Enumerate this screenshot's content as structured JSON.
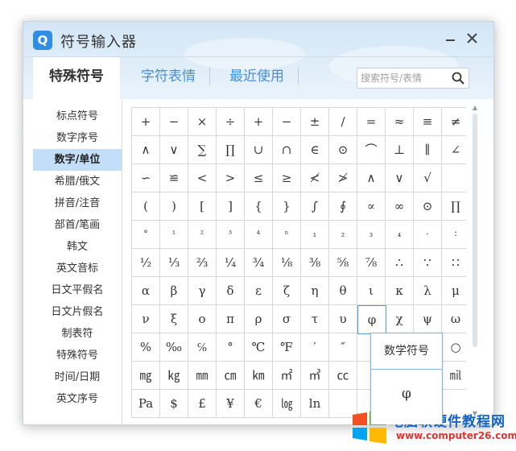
{
  "window": {
    "title": "符号输入器",
    "logo": "Q"
  },
  "tabs": [
    "特殊符号",
    "字符表情",
    "最近使用"
  ],
  "search": {
    "placeholder": "搜索符号/表情"
  },
  "sidebar": [
    "标点符号",
    "数字序号",
    "数字/单位",
    "希腊/俄文",
    "拼音/注音",
    "部首/笔画",
    "韩文",
    "英文音标",
    "日文平假名",
    "日文片假名",
    "制表符",
    "特殊符号",
    "时间/日期",
    "英文序号"
  ],
  "sidebar_active": 2,
  "grid": [
    [
      "+",
      "−",
      "×",
      "÷",
      "+",
      "−",
      "±",
      "∕",
      "=",
      "≈",
      "≡",
      "≠"
    ],
    [
      "∧",
      "∨",
      "∑",
      "∏",
      "∪",
      "∩",
      "∈",
      "⊙",
      "⌒",
      "⊥",
      "∥",
      "∠"
    ],
    [
      "∽",
      "≌",
      "<",
      ">",
      "≤",
      "≥",
      "≮",
      "≯",
      "∧",
      "∨",
      "√",
      ""
    ],
    [
      "(",
      ")",
      "[",
      "]",
      "{",
      "}",
      "∫",
      "∮",
      "∝",
      "∞",
      "⊙",
      "∏"
    ],
    [
      "°",
      "¹",
      "²",
      "³",
      "⁴",
      "ⁿ",
      "₁",
      "₂",
      "₃",
      "₄",
      "·",
      "∶"
    ],
    [
      "½",
      "⅓",
      "⅔",
      "¼",
      "¾",
      "⅛",
      "⅜",
      "⅝",
      "⅞",
      "∴",
      "∵",
      "∷"
    ],
    [
      "α",
      "β",
      "γ",
      "δ",
      "ε",
      "ζ",
      "η",
      "θ",
      "ι",
      "κ",
      "λ",
      "μ"
    ],
    [
      "ν",
      "ξ",
      "ο",
      "π",
      "ρ",
      "σ",
      "τ",
      "υ",
      "φ",
      "χ",
      "ψ",
      "ω"
    ],
    [
      "%",
      "‰",
      "℅",
      "°",
      "℃",
      "℉",
      "′",
      "″",
      "",
      "",
      "",
      "○"
    ],
    [
      "㎎",
      "㎏",
      "㎜",
      "㎝",
      "㎞",
      "㎡",
      "㎥",
      "㏄",
      "",
      "",
      "",
      "㏕"
    ],
    [
      "Pa",
      "$",
      "£",
      "¥",
      "€",
      "㏒",
      "ln",
      "",
      "",
      "",
      "",
      ""
    ]
  ],
  "highlight": {
    "row": 7,
    "col": 8
  },
  "popup": {
    "title": "数学符号",
    "symbol": "φ"
  },
  "watermark": {
    "text": "电脑软硬件教程网",
    "url": "www.computer26.com"
  }
}
